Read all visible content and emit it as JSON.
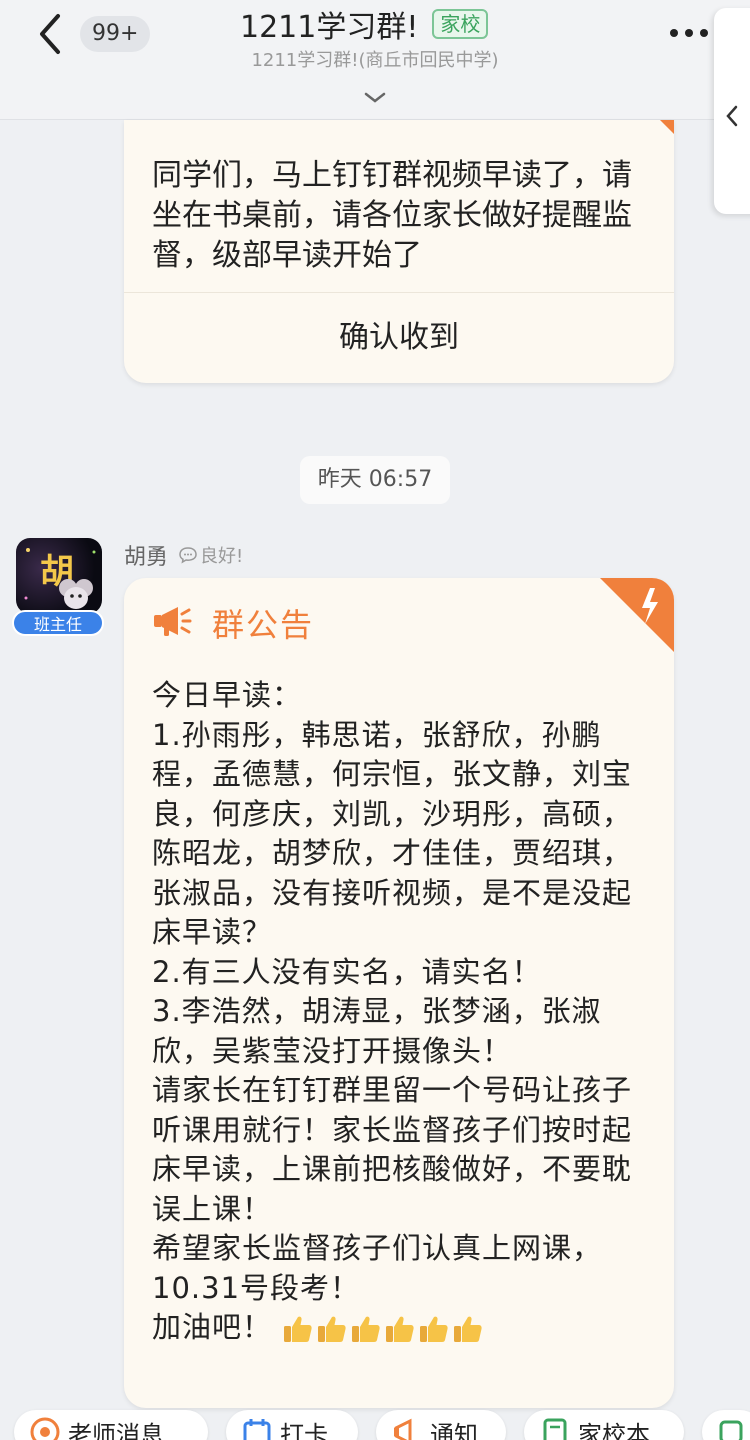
{
  "header": {
    "unread_count": "99+",
    "title": "1211学习群!",
    "tag": "家校",
    "subtitle": "1211学习群!(商丘市回民中学)"
  },
  "messages": {
    "first": {
      "text": "同学们，马上钉钉群视频早读了，请坐在书桌前，请各位家长做好提醒监督，级部早读开始了",
      "confirm_label": "确认收到"
    },
    "timestamp": "昨天 06:57",
    "second": {
      "avatar_char": "胡",
      "role": "班主任",
      "sender": "胡勇",
      "status": "良好!",
      "announce_title": "群公告",
      "lines": [
        "今日早读：",
        "1.孙雨彤，韩思诺，张舒欣，孙鹏程，孟德慧，何宗恒，张文静，刘宝良，何彦庆，刘凯，沙玥彤，高硕，陈昭龙，胡梦欣，才佳佳，贾绍琪，张淑品，没有接听视频，是不是没起床早读？",
        "2.有三人没有实名，请实名！",
        "3.李浩然，胡涛显，张梦涵，张淑欣，吴紫莹没打开摄像头！",
        "请家长在钉钉群里留一个号码让孩子听课用就行！家长监督孩子们按时起床早读，上课前把核酸做好，不要耽误上课！",
        "希望家长监督孩子们认真上网课，10.31号段考！"
      ],
      "closing": "加油吧！"
    }
  },
  "quick_bar": {
    "items": [
      "老师消息",
      "打卡",
      "通知",
      "家校本"
    ]
  },
  "colors": {
    "accent_orange": "#f0803c",
    "badge_blue": "#3b82e8",
    "tag_green": "#3aa35d"
  }
}
